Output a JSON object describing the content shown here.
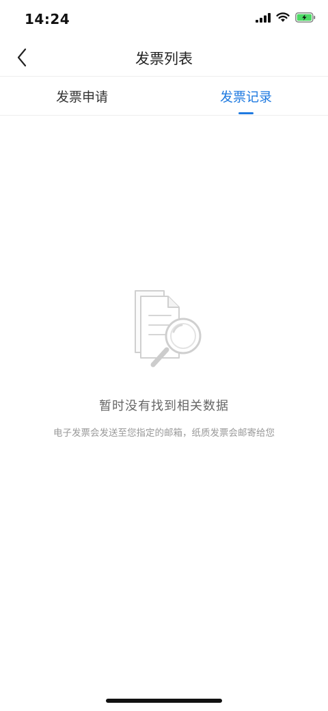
{
  "status_bar": {
    "time": "14:24",
    "icons": [
      "cellular-signal-icon",
      "wifi-icon",
      "battery-charging-icon"
    ],
    "battery_color": "#4cd964"
  },
  "nav": {
    "back_icon": "chevron-left-icon",
    "title": "发票列表"
  },
  "tabs": [
    {
      "label": "发票申请",
      "active": false
    },
    {
      "label": "发票记录",
      "active": true
    }
  ],
  "empty_state": {
    "icon": "document-search-icon",
    "title": "暂时没有找到相关数据",
    "subtitle": "电子发票会发送至您指定的邮箱，纸质发票会邮寄给您"
  },
  "colors": {
    "accent": "#1f7ae0",
    "text_primary": "#222222",
    "text_secondary": "#666666",
    "text_hint": "#999999",
    "divider": "#eeeeee"
  }
}
